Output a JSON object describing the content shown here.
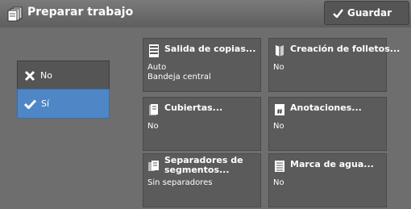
{
  "header": {
    "title": "Preparar trabajo",
    "save_label": "Guardar"
  },
  "options": {
    "no_label": "No",
    "si_label": "Sí"
  },
  "tiles": [
    {
      "name": "Salida de copias...",
      "values": [
        "Auto",
        "Bandeja central"
      ]
    },
    {
      "name": "Creación de folletos...",
      "values": [
        "No"
      ]
    },
    {
      "name": "Cubiertas...",
      "values": [
        "No"
      ]
    },
    {
      "name": "Anotaciones...",
      "values": [
        "No"
      ]
    },
    {
      "name": [
        "Separadores de",
        "segmentos..."
      ],
      "values": [
        "Sin separadores"
      ]
    },
    {
      "name": "Marca de agua...",
      "values": [
        "No"
      ]
    }
  ],
  "colors": {
    "selected": "#4f86c6",
    "tile": "#5b5b5b",
    "background": "#6e6e6e"
  }
}
